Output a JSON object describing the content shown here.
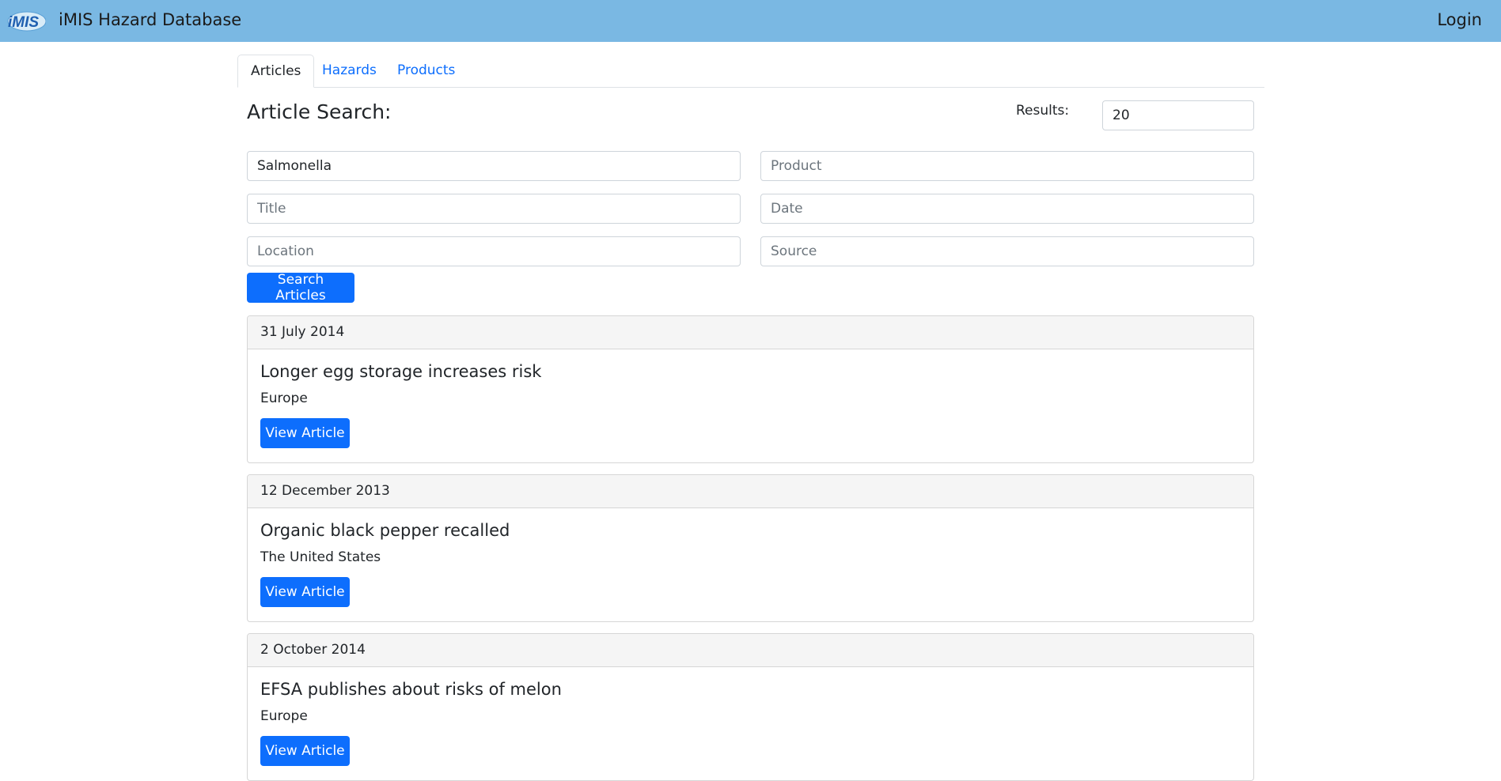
{
  "app": {
    "logo_text": "iMIS",
    "brand": "iMIS Hazard Database",
    "login_label": "Login"
  },
  "tabs": [
    {
      "label": "Articles",
      "active": true
    },
    {
      "label": "Hazards",
      "active": false
    },
    {
      "label": "Products",
      "active": false
    }
  ],
  "search": {
    "title": "Article Search:",
    "results_label": "Results:",
    "results_value": "20",
    "hazard_value": "Salmonella",
    "product_placeholder": "Product",
    "title_placeholder": "Title",
    "date_placeholder": "Date",
    "location_placeholder": "Location",
    "source_placeholder": "Source",
    "button_label": "Search Articles"
  },
  "articles": [
    {
      "date": "31 July 2014",
      "title": "Longer egg storage increases risk",
      "location": "Europe",
      "button": "View Article"
    },
    {
      "date": "12 December 2013",
      "title": "Organic black pepper recalled",
      "location": "The United States",
      "button": "View Article"
    },
    {
      "date": "2 October 2014",
      "title": "EFSA publishes about risks of melon",
      "location": "Europe",
      "button": "View Article"
    }
  ],
  "colors": {
    "navbar": "#7ab8e3",
    "primary": "#0d6efd",
    "link": "#0d6efd"
  }
}
